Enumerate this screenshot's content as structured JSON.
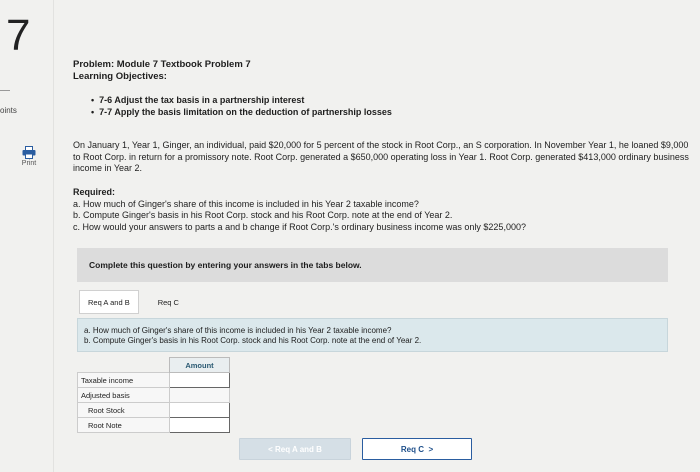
{
  "question_number": "7",
  "points_label": "oints",
  "print_label": "Print",
  "problem_title": "Problem: Module 7 Textbook Problem 7",
  "objectives_heading": "Learning Objectives:",
  "objectives": [
    "7-6 Adjust the tax basis in a partnership interest",
    "7-7 Apply the basis limitation on the deduction of partnership losses"
  ],
  "problem_text": "On January 1, Year 1, Ginger, an individual, paid $20,000 for 5 percent of the stock in Root Corp., an S corporation. In November Year 1, he loaned $9,000 to Root Corp. in return for a promissory note. Root Corp. generated a $650,000 operating loss in Year 1. Root Corp. generated $413,000 ordinary business income in Year 2.",
  "required_heading": "Required:",
  "required_items": [
    "a. How much of Ginger's share of this income is included in his Year 2 taxable income?",
    "b. Compute Ginger's basis in his Root Corp. stock and his Root Corp. note at the end of Year 2.",
    "c. How would your answers to parts a and b change if Root Corp.'s ordinary business income was only $225,000?"
  ],
  "banner_text": "Complete this question by entering your answers in the tabs below.",
  "tabs": [
    {
      "label": "Req A and B",
      "active": true
    },
    {
      "label": "Req C",
      "active": false
    }
  ],
  "instructions": [
    "a. How much of Ginger's share of this income is included in his Year 2 taxable income?",
    "b. Compute Ginger's basis in his Root Corp. stock and his Root Corp. note at the end of Year 2."
  ],
  "table": {
    "column_header": "Amount",
    "rows": [
      {
        "label": "Taxable income",
        "value": ""
      },
      {
        "label": "Adjusted basis",
        "value": null
      },
      {
        "label": "Root Stock",
        "value": ""
      },
      {
        "label": "Root Note",
        "value": ""
      }
    ]
  },
  "nav": {
    "prev_label": "Req A and B",
    "next_label": "Req C"
  },
  "colors": {
    "accent": "#2a5da0",
    "instruction_bg": "#dbe8ec",
    "banner_bg": "#dcdcdc"
  }
}
